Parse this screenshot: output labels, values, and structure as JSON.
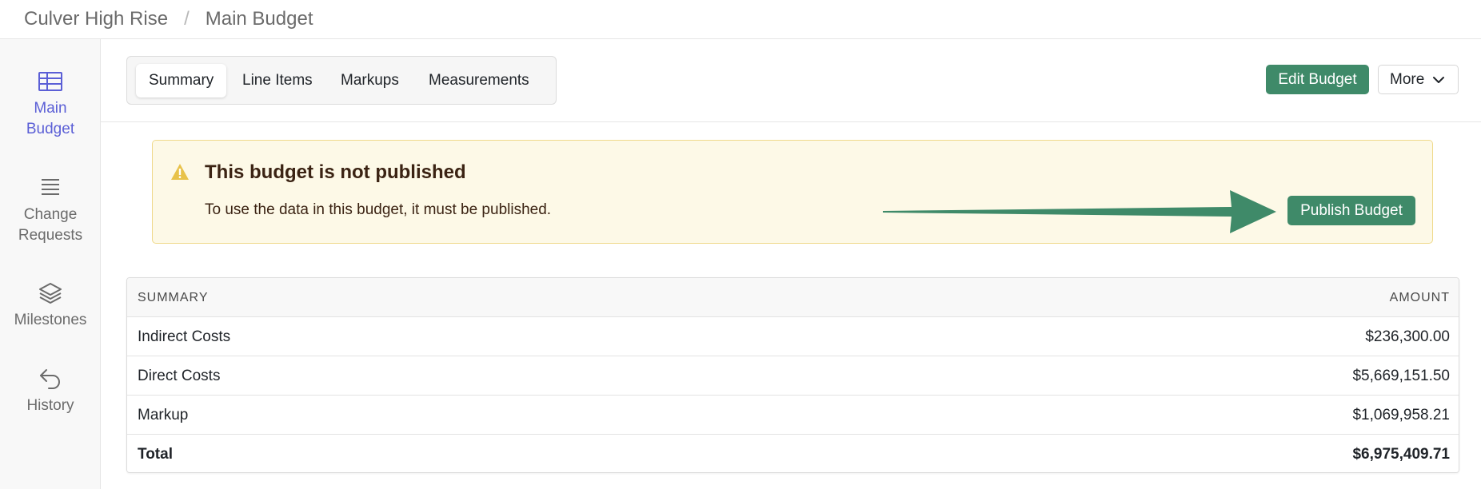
{
  "breadcrumb": {
    "project": "Culver High Rise",
    "separator": "/",
    "page": "Main Budget"
  },
  "sidebar": {
    "items": [
      {
        "line1": "Main",
        "line2": "Budget",
        "icon": "table-icon",
        "active": true
      },
      {
        "line1": "Change",
        "line2": "Requests",
        "icon": "list-icon",
        "active": false
      },
      {
        "line1": "Milestones",
        "line2": "",
        "icon": "layers-icon",
        "active": false
      },
      {
        "line1": "History",
        "line2": "",
        "icon": "undo-arrow-icon",
        "active": false
      }
    ]
  },
  "tabs": [
    {
      "label": "Summary",
      "active": true
    },
    {
      "label": "Line Items",
      "active": false
    },
    {
      "label": "Markups",
      "active": false
    },
    {
      "label": "Measurements",
      "active": false
    }
  ],
  "toolbar": {
    "edit_label": "Edit Budget",
    "more_label": "More"
  },
  "banner": {
    "title": "This budget is not published",
    "message": "To use the data in this budget, it must be published.",
    "button_label": "Publish Budget",
    "icon": "warning-triangle-icon"
  },
  "summary_table": {
    "headers": {
      "left": "SUMMARY",
      "right": "AMOUNT"
    },
    "rows": [
      {
        "label": "Indirect Costs",
        "amount": "$236,300.00"
      },
      {
        "label": "Direct Costs",
        "amount": "$5,669,151.50"
      },
      {
        "label": "Markup",
        "amount": "$1,069,958.21"
      }
    ],
    "total": {
      "label": "Total",
      "amount": "$6,975,409.71"
    }
  },
  "colors": {
    "accent": "#5b5fd6",
    "primary_button": "#3f8a69",
    "banner_bg": "#fdf9e7",
    "banner_border": "#efd98a",
    "warning_icon": "#e8c24a"
  }
}
